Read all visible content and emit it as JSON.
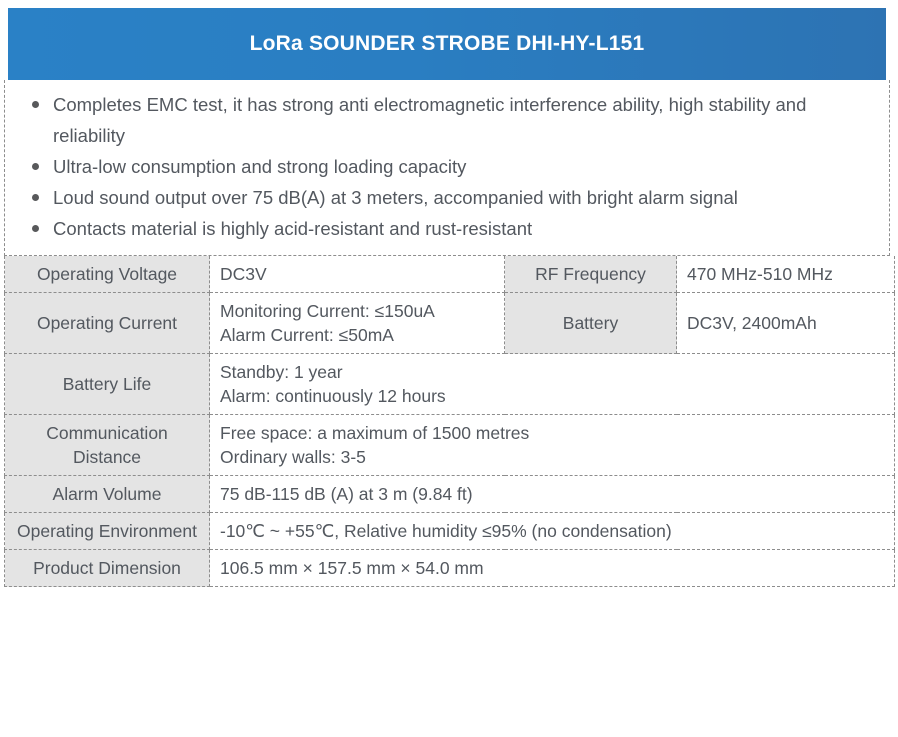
{
  "header": {
    "title": "LoRa SOUNDER STROBE DHI-HY-L151",
    "background_start": "#2a81c6",
    "background_end": "#2d73b3",
    "text_color": "#ffffff"
  },
  "features": {
    "bullet_color": "#58595b",
    "items": [
      "Completes EMC test, it has strong anti electromagnetic interference ability, high stability and reliability",
      "Ultra-low consumption and strong loading capacity",
      "Loud sound output over 75 dB(A) at 3 meters, accompanied with bright alarm signal",
      "Contacts material is highly acid-resistant and rust-resistant"
    ]
  },
  "spec_table": {
    "label_bg": "#e4e4e4",
    "text_color": "#53585f",
    "border_color": "#8d8d8d",
    "rows": [
      {
        "label1": "Operating Voltage",
        "value1": "DC3V",
        "label2": "RF Frequency",
        "value2": "470 MHz-510 MHz"
      },
      {
        "label1": "Operating Current",
        "value1_line1": "Monitoring Current: ≤150uA",
        "value1_line2": "Alarm Current: ≤50mA",
        "label2": "Battery",
        "value2": "DC3V, 2400mAh"
      },
      {
        "label1": "Battery Life",
        "value1_line1": "Standby: 1 year",
        "value1_line2": "Alarm: continuously 12 hours"
      },
      {
        "label1": "Communication Distance",
        "value1_line1": "Free space: a maximum of 1500 metres",
        "value1_line2": "Ordinary walls: 3-5"
      },
      {
        "label1": "Alarm Volume",
        "value1": "75 dB-115 dB (A) at 3 m (9.84 ft)"
      },
      {
        "label1": "Operating Environment",
        "value1": "-10℃ ~ +55℃, Relative humidity ≤95% (no condensation)"
      },
      {
        "label1": "Product Dimension",
        "value1": "106.5 mm × 157.5 mm × 54.0 mm"
      }
    ]
  }
}
